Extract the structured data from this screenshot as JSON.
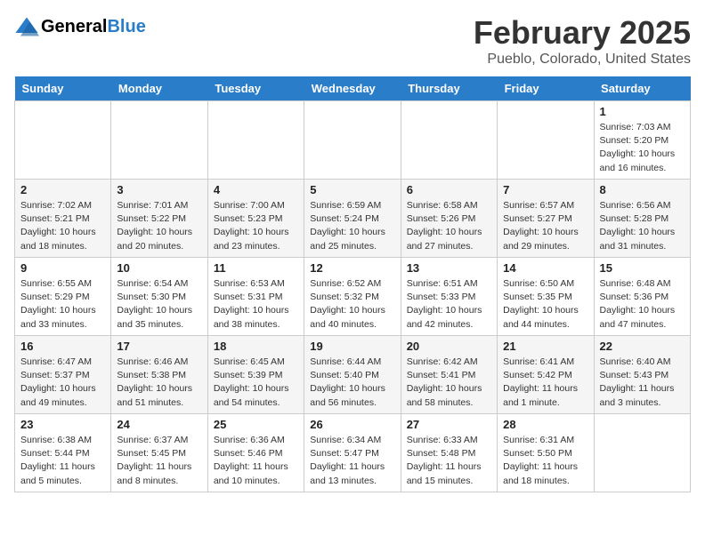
{
  "header": {
    "logo": "GeneralBlue",
    "title": "February 2025",
    "location": "Pueblo, Colorado, United States"
  },
  "days_of_week": [
    "Sunday",
    "Monday",
    "Tuesday",
    "Wednesday",
    "Thursday",
    "Friday",
    "Saturday"
  ],
  "weeks": [
    [
      {
        "day": "",
        "info": ""
      },
      {
        "day": "",
        "info": ""
      },
      {
        "day": "",
        "info": ""
      },
      {
        "day": "",
        "info": ""
      },
      {
        "day": "",
        "info": ""
      },
      {
        "day": "",
        "info": ""
      },
      {
        "day": "1",
        "info": "Sunrise: 7:03 AM\nSunset: 5:20 PM\nDaylight: 10 hours\nand 16 minutes."
      }
    ],
    [
      {
        "day": "2",
        "info": "Sunrise: 7:02 AM\nSunset: 5:21 PM\nDaylight: 10 hours\nand 18 minutes."
      },
      {
        "day": "3",
        "info": "Sunrise: 7:01 AM\nSunset: 5:22 PM\nDaylight: 10 hours\nand 20 minutes."
      },
      {
        "day": "4",
        "info": "Sunrise: 7:00 AM\nSunset: 5:23 PM\nDaylight: 10 hours\nand 23 minutes."
      },
      {
        "day": "5",
        "info": "Sunrise: 6:59 AM\nSunset: 5:24 PM\nDaylight: 10 hours\nand 25 minutes."
      },
      {
        "day": "6",
        "info": "Sunrise: 6:58 AM\nSunset: 5:26 PM\nDaylight: 10 hours\nand 27 minutes."
      },
      {
        "day": "7",
        "info": "Sunrise: 6:57 AM\nSunset: 5:27 PM\nDaylight: 10 hours\nand 29 minutes."
      },
      {
        "day": "8",
        "info": "Sunrise: 6:56 AM\nSunset: 5:28 PM\nDaylight: 10 hours\nand 31 minutes."
      }
    ],
    [
      {
        "day": "9",
        "info": "Sunrise: 6:55 AM\nSunset: 5:29 PM\nDaylight: 10 hours\nand 33 minutes."
      },
      {
        "day": "10",
        "info": "Sunrise: 6:54 AM\nSunset: 5:30 PM\nDaylight: 10 hours\nand 35 minutes."
      },
      {
        "day": "11",
        "info": "Sunrise: 6:53 AM\nSunset: 5:31 PM\nDaylight: 10 hours\nand 38 minutes."
      },
      {
        "day": "12",
        "info": "Sunrise: 6:52 AM\nSunset: 5:32 PM\nDaylight: 10 hours\nand 40 minutes."
      },
      {
        "day": "13",
        "info": "Sunrise: 6:51 AM\nSunset: 5:33 PM\nDaylight: 10 hours\nand 42 minutes."
      },
      {
        "day": "14",
        "info": "Sunrise: 6:50 AM\nSunset: 5:35 PM\nDaylight: 10 hours\nand 44 minutes."
      },
      {
        "day": "15",
        "info": "Sunrise: 6:48 AM\nSunset: 5:36 PM\nDaylight: 10 hours\nand 47 minutes."
      }
    ],
    [
      {
        "day": "16",
        "info": "Sunrise: 6:47 AM\nSunset: 5:37 PM\nDaylight: 10 hours\nand 49 minutes."
      },
      {
        "day": "17",
        "info": "Sunrise: 6:46 AM\nSunset: 5:38 PM\nDaylight: 10 hours\nand 51 minutes."
      },
      {
        "day": "18",
        "info": "Sunrise: 6:45 AM\nSunset: 5:39 PM\nDaylight: 10 hours\nand 54 minutes."
      },
      {
        "day": "19",
        "info": "Sunrise: 6:44 AM\nSunset: 5:40 PM\nDaylight: 10 hours\nand 56 minutes."
      },
      {
        "day": "20",
        "info": "Sunrise: 6:42 AM\nSunset: 5:41 PM\nDaylight: 10 hours\nand 58 minutes."
      },
      {
        "day": "21",
        "info": "Sunrise: 6:41 AM\nSunset: 5:42 PM\nDaylight: 11 hours\nand 1 minute."
      },
      {
        "day": "22",
        "info": "Sunrise: 6:40 AM\nSunset: 5:43 PM\nDaylight: 11 hours\nand 3 minutes."
      }
    ],
    [
      {
        "day": "23",
        "info": "Sunrise: 6:38 AM\nSunset: 5:44 PM\nDaylight: 11 hours\nand 5 minutes."
      },
      {
        "day": "24",
        "info": "Sunrise: 6:37 AM\nSunset: 5:45 PM\nDaylight: 11 hours\nand 8 minutes."
      },
      {
        "day": "25",
        "info": "Sunrise: 6:36 AM\nSunset: 5:46 PM\nDaylight: 11 hours\nand 10 minutes."
      },
      {
        "day": "26",
        "info": "Sunrise: 6:34 AM\nSunset: 5:47 PM\nDaylight: 11 hours\nand 13 minutes."
      },
      {
        "day": "27",
        "info": "Sunrise: 6:33 AM\nSunset: 5:48 PM\nDaylight: 11 hours\nand 15 minutes."
      },
      {
        "day": "28",
        "info": "Sunrise: 6:31 AM\nSunset: 5:50 PM\nDaylight: 11 hours\nand 18 minutes."
      },
      {
        "day": "",
        "info": ""
      }
    ]
  ]
}
